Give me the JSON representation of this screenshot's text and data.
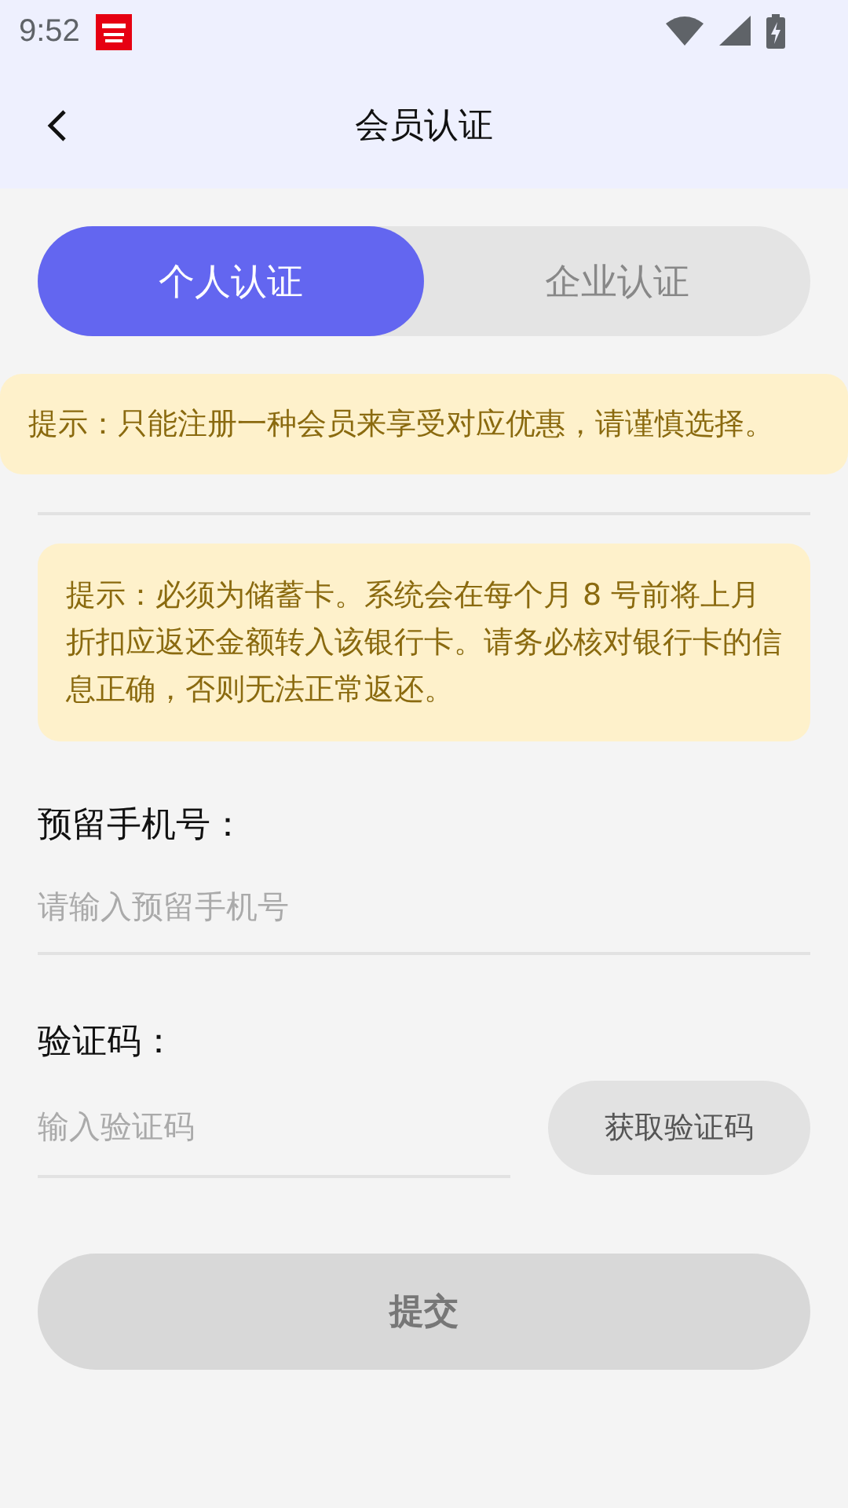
{
  "status_bar": {
    "time": "9:52"
  },
  "header": {
    "title": "会员认证"
  },
  "tabs": [
    {
      "label": "个人认证",
      "selected": true
    },
    {
      "label": "企业认证",
      "selected": false
    }
  ],
  "notice": "提示：只能注册一种会员来享受对应优惠，请谨慎选择。",
  "bank_notice": "提示：必须为储蓄卡。系统会在每个月 8 号前将上月折扣应返还金额转入该银行卡。请务必核对银行卡的信息正确，否则无法正常返还。",
  "phone": {
    "label": "预留手机号：",
    "placeholder": "请输入预留手机号"
  },
  "code": {
    "label": "验证码：",
    "placeholder": "输入验证码",
    "button": "获取验证码"
  },
  "submit": {
    "label": "提交",
    "disabled": true
  }
}
